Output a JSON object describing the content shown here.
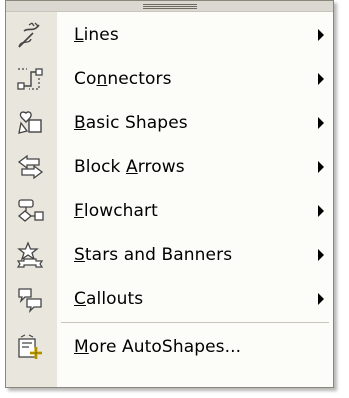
{
  "menu": {
    "items": [
      {
        "icon": "lines-icon",
        "parts": [
          "",
          "L",
          "ines"
        ],
        "submenu": true
      },
      {
        "icon": "connectors-icon",
        "parts": [
          "Co",
          "n",
          "nectors"
        ],
        "submenu": true
      },
      {
        "icon": "basic-shapes-icon",
        "parts": [
          "",
          "B",
          "asic Shapes"
        ],
        "submenu": true
      },
      {
        "icon": "block-arrows-icon",
        "parts": [
          "Block ",
          "A",
          "rrows"
        ],
        "submenu": true
      },
      {
        "icon": "flowchart-icon",
        "parts": [
          "",
          "F",
          "lowchart"
        ],
        "submenu": true
      },
      {
        "icon": "stars-and-banners-icon",
        "parts": [
          "",
          "S",
          "tars and Banners"
        ],
        "submenu": true
      },
      {
        "icon": "callouts-icon",
        "parts": [
          "",
          "C",
          "allouts"
        ],
        "submenu": true
      },
      {
        "icon": "more-autoshapes-icon",
        "parts": [
          "",
          "M",
          "ore AutoShapes..."
        ],
        "submenu": false
      }
    ]
  }
}
